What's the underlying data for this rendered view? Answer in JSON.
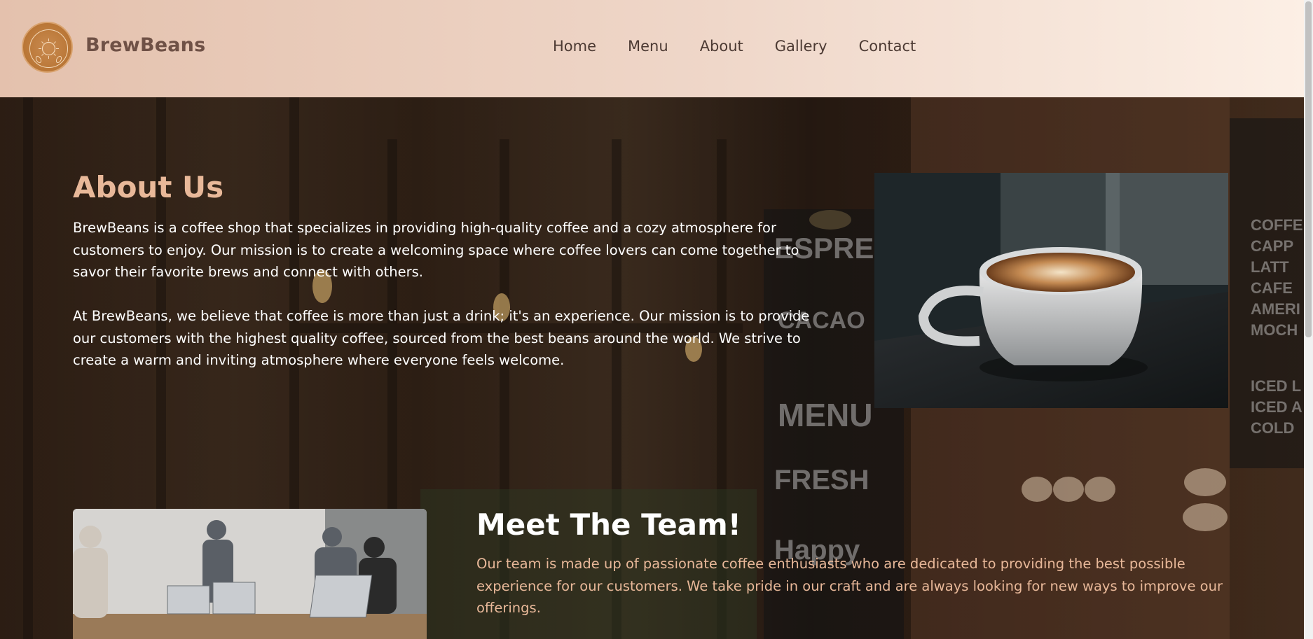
{
  "header": {
    "brand": "BrewBeans",
    "logo_text": "BREWBEANS",
    "nav": [
      "Home",
      "Menu",
      "About",
      "Gallery",
      "Contact"
    ]
  },
  "about": {
    "title": "About Us",
    "paragraph1": "BrewBeans is a coffee shop that specializes in providing high-quality coffee and a cozy atmosphere for customers to enjoy. Our mission is to create a welcoming space where coffee lovers can come together to savor their favorite brews and connect with others.",
    "paragraph2": "At BrewBeans, we believe that coffee is more than just a drink; it's an experience. Our mission is to provide our customers with the highest quality coffee, sourced from the best beans around the world. We strive to create a warm and inviting atmosphere where everyone feels welcome."
  },
  "team": {
    "title": "Meet The Team!",
    "text": "Our team is made up of passionate coffee enthusiasts who are dedicated to providing the best possible experience for our customers. We take pride in our craft and are always looking for new ways to improve our offerings."
  },
  "colors": {
    "accent": "#e8b899",
    "brand_text": "#6f5146",
    "nav_text": "#4c3a33"
  },
  "icons": {
    "logo": "coffee-bean-logo-icon"
  }
}
